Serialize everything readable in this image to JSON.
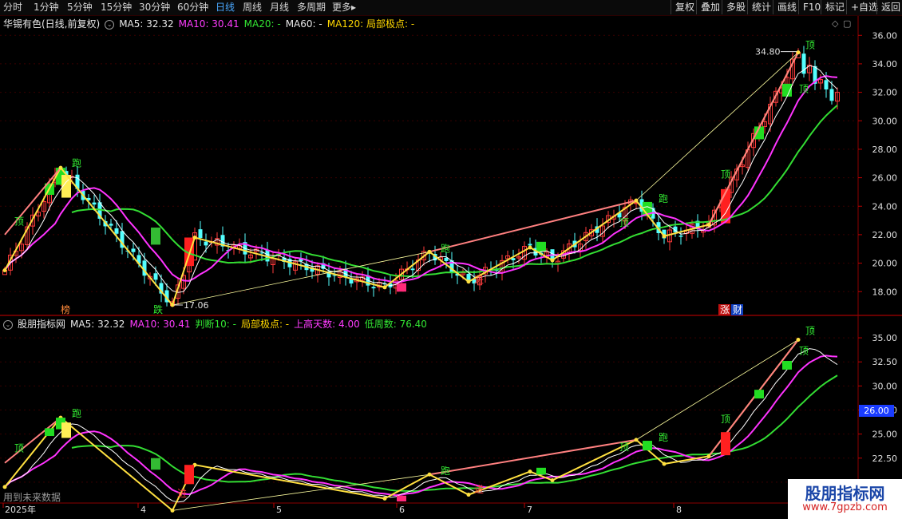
{
  "toolbar": {
    "periods": [
      "分时",
      "1分钟",
      "5分钟",
      "15分钟",
      "30分钟",
      "60分钟",
      "日线",
      "周线",
      "月线",
      "多周期",
      "更多"
    ],
    "active_period": "日线",
    "more_arrow": "▸",
    "right_buttons": [
      "复权",
      "叠加",
      "多股",
      "统计",
      "画线",
      "F10",
      "标记",
      "+自选",
      "返回"
    ]
  },
  "main_panel": {
    "title": "华锡有色(日线,前复权)",
    "ma5": "MA5: 32.32",
    "ma10": "MA10: 30.41",
    "ma20": "MA20: -",
    "ma60": "MA60: -",
    "ma120": "MA120: 局部极点: -",
    "axis_ticks": [
      "36.00",
      "34.00",
      "32.00",
      "30.00",
      "28.00",
      "26.00",
      "24.00",
      "22.00",
      "20.00",
      "18.00"
    ],
    "label_high": "34.80",
    "label_low": "17.06",
    "markers": {
      "bang": "榜",
      "die": "跌",
      "zhang": "涨",
      "cai": "财"
    }
  },
  "lower_panel": {
    "title": "股朋指标网",
    "ma5": "MA5: 32.32",
    "ma10": "MA10: 30.41",
    "judge": "判断10: -",
    "extreme": "局部极点: -",
    "up_days": "上高天数: 4.00",
    "low_weeks": "低周数: 76.40",
    "axis_ticks": [
      "35.00",
      "32.50",
      "30.00",
      "27.50",
      "25.00",
      "22.50",
      "20.00"
    ],
    "cursor_price": "26.00"
  },
  "signals": {
    "top": "顶",
    "run": "跑",
    "enter": "进"
  },
  "footer": {
    "note": "用到未来数据",
    "dates": [
      "2025年",
      "4",
      "5",
      "6",
      "7",
      "8"
    ]
  },
  "watermark": {
    "title": "股朋指标网",
    "url": "www.7gpzb.com"
  },
  "colors": {
    "up": "#ff3b3b",
    "down": "#54ffff",
    "ma5": "#ffffff",
    "ma10": "#ff33ff",
    "ma20": "#33dd33",
    "zigzag": "#ffe040",
    "pink": "#ff8080"
  },
  "chart_data": {
    "type": "candlestick",
    "title": "华锡有色(日线,前复权)",
    "price_range": [
      16.5,
      36.8
    ],
    "indicator_range": [
      18.0,
      36.5
    ],
    "zigzag_pivots": [
      {
        "i": 0,
        "v": 19.5
      },
      {
        "i": 10,
        "v": 26.7
      },
      {
        "i": 30,
        "v": 17.06
      },
      {
        "i": 34,
        "v": 21.8
      },
      {
        "i": 68,
        "v": 18.3
      },
      {
        "i": 76,
        "v": 20.8
      },
      {
        "i": 83,
        "v": 18.7
      },
      {
        "i": 94,
        "v": 21.1
      },
      {
        "i": 98,
        "v": 20.2
      },
      {
        "i": 113,
        "v": 24.4
      },
      {
        "i": 118,
        "v": 21.9
      },
      {
        "i": 126,
        "v": 22.7
      },
      {
        "i": 142,
        "v": 34.8
      }
    ],
    "ohlc": []
  }
}
